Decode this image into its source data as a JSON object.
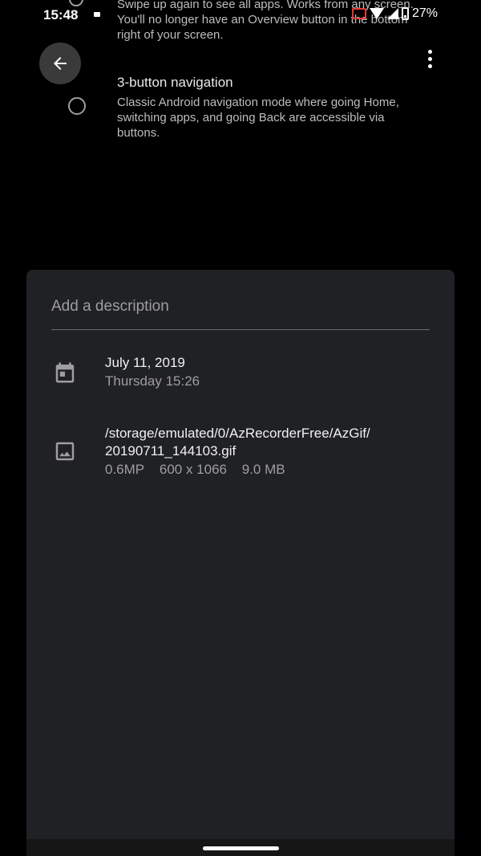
{
  "status_bar": {
    "time": "15:48",
    "battery": "27%",
    "icons": [
      "cast-icon",
      "wifi-icon",
      "signal-icon",
      "battery-icon"
    ]
  },
  "background_page": {
    "partial_text": "Swipe up again to see all apps. Works from any screen. You'll no longer have an Overview button in the bottom right of your screen.",
    "option_title": "3-button navigation",
    "option_desc": "Classic Android navigation mode where going Home, switching apps, and going Back are accessible via buttons."
  },
  "toolbar": {
    "back_icon": "arrow-back-icon",
    "more_icon": "more-vert-icon"
  },
  "info_sheet": {
    "description_placeholder": "Add a description",
    "date": {
      "icon": "calendar-icon",
      "primary": "July 11, 2019",
      "secondary": "Thursday 15:26"
    },
    "file": {
      "icon": "image-icon",
      "path_line1": "/storage/emulated/0/AzRecorderFree/AzGif/",
      "path_line2": "20190711_144103.gif",
      "megapixels": "0.6MP",
      "dimensions": "600 x 1066",
      "size": "9.0 MB"
    }
  },
  "colors": {
    "sheet_background": "#202124",
    "text_primary": "#f1f1f1",
    "text_secondary": "#9e9e9e",
    "cast_accent": "#e53935"
  }
}
